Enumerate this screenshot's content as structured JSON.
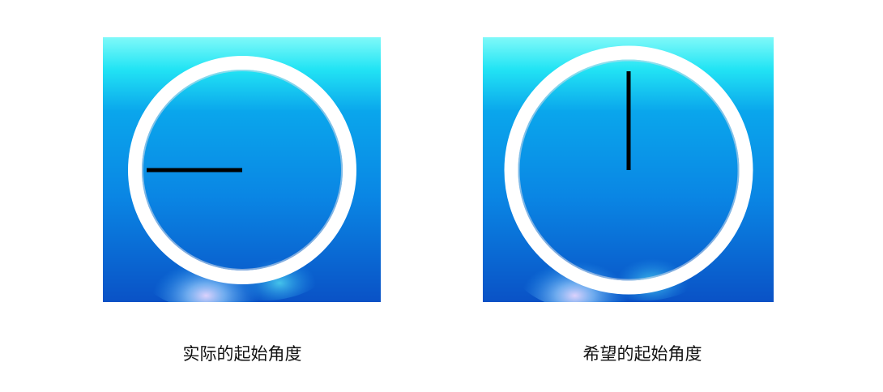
{
  "panels": [
    {
      "caption": "实际的起始角度",
      "hand_direction": "left",
      "hand_color": "#000000"
    },
    {
      "caption": "希望的起始角度",
      "hand_direction": "up",
      "hand_color": "#000000"
    }
  ],
  "colors": {
    "background_top": "#4ff3f6",
    "background_mid": "#0b8fe6",
    "background_bottom": "#0a4fc4",
    "ring": "#ffffff"
  }
}
